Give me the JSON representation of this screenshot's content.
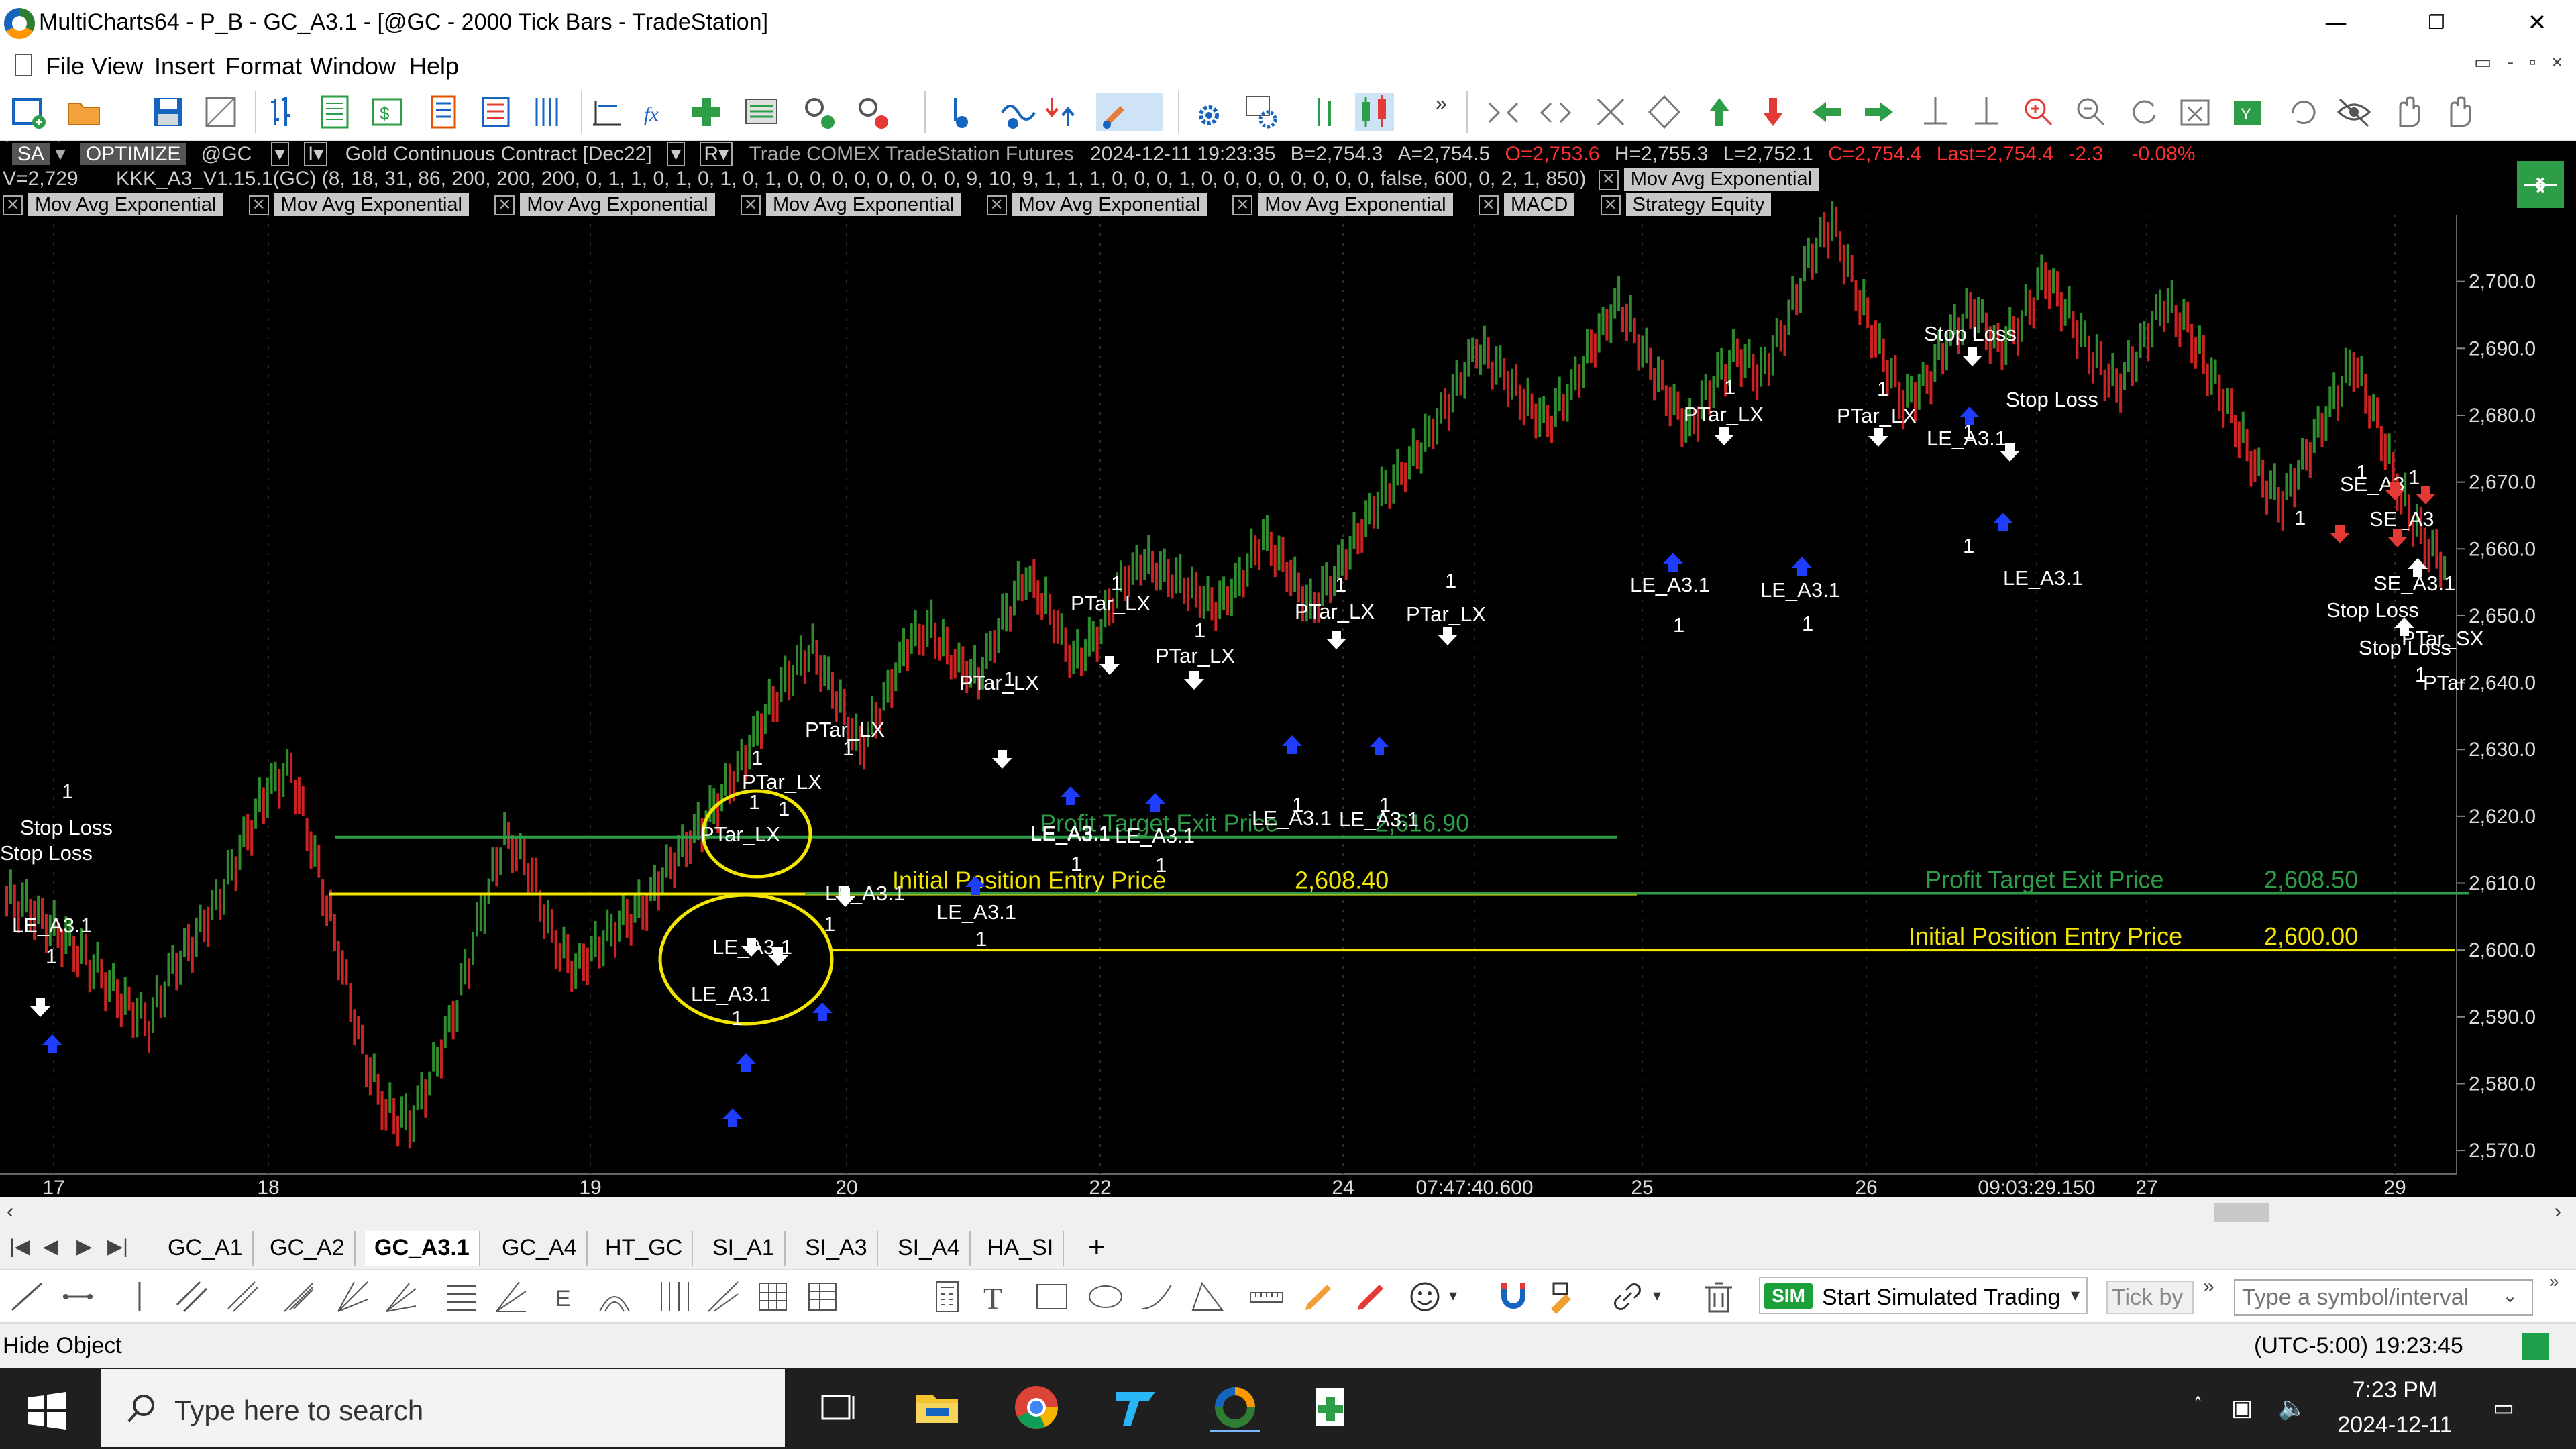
{
  "window": {
    "title": "MultiCharts64 - P_B - GC_A3.1 - [@GC - 2000 Tick Bars - TradeStation]",
    "controls": [
      "—",
      "❐",
      "✕"
    ]
  },
  "menu": {
    "items": [
      "File",
      "View",
      "Insert",
      "Format",
      "Window",
      "Help"
    ]
  },
  "chart_header": {
    "mode": "SA",
    "optimize": "OPTIMIZE",
    "symbol": "@GC",
    "interval_marker": "I▾",
    "description": "Gold Continuous Contract [Dec22]",
    "r_marker": "R▾",
    "feed": "Trade  COMEX  TradeStation  Futures",
    "datetime": "2024-12-11   19:23:35",
    "bid": "B=2,754.3",
    "ask": "A=2,754.5",
    "open": "O=2,753.6",
    "high": "H=2,755.3",
    "low": "L=2,752.1",
    "close": "C=2,754.4",
    "last": "Last=2,754.4",
    "change": "-2.3",
    "change_pct": "-0.08%",
    "volume": "V=2,729",
    "strategy": "KKK_A3_V1.15.1(GC) (8,  18,  31,  86,  200,  200,  200,  0,  1,  1,  0,  1,  0,  1,  0,  1,  0,  0,  0,  0,  0,  0,  0,  0,  9,  10,  9,  1,  1,  1,  0,  0,  0,  1,  0,  0,  0,  0,  0,  0,  0,  0,  false,  600,  0,  2,  1,  850)",
    "last_indicator": "Mov Avg Exponential",
    "indicators": [
      "Mov Avg Exponential",
      "Mov Avg Exponential",
      "Mov Avg Exponential",
      "Mov Avg Exponential",
      "Mov Avg Exponential",
      "Mov Avg Exponential",
      "MACD",
      "Strategy Equity"
    ]
  },
  "chart_data": {
    "type": "line",
    "series": [
      {
        "values": [
          2608,
          2606,
          2603,
          2600,
          2596,
          2592,
          2589,
          2597,
          2602,
          2608,
          2616,
          2624,
          2627,
          2614,
          2600,
          2585,
          2576,
          2574,
          2582,
          2592,
          2605,
          2617,
          2613,
          2602,
          2597,
          2601,
          2604,
          2607,
          2613,
          2617,
          2622,
          2628,
          2635,
          2641,
          2645,
          2638,
          2630,
          2637,
          2646,
          2648,
          2643,
          2641,
          2649,
          2656,
          2651,
          2643,
          2647,
          2655,
          2658,
          2656,
          2654,
          2651,
          2655,
          2662,
          2657,
          2651,
          2656,
          2662,
          2668,
          2672,
          2677,
          2683,
          2690,
          2687,
          2682,
          2679,
          2684,
          2691,
          2697,
          2690,
          2683,
          2678,
          2685,
          2689,
          2686,
          2693,
          2703,
          2709,
          2699,
          2690,
          2682,
          2685,
          2692,
          2696,
          2690,
          2694,
          2701,
          2695,
          2689,
          2684,
          2690,
          2697,
          2693,
          2686,
          2679,
          2671,
          2667,
          2674,
          2681,
          2688,
          2679,
          2668,
          2661,
          2657
        ]
      }
    ],
    "y_ticks": [
      "2,700.0",
      "2,690.0",
      "2,680.0",
      "2,670.0",
      "2,660.0",
      "2,650.0",
      "2,640.0",
      "2,630.0",
      "2,620.0",
      "2,610.0",
      "2,600.0",
      "2,590.0",
      "2,580.0",
      "2,570.0"
    ],
    "ylim": [
      2567,
      2710
    ],
    "x_ticks": [
      "17",
      "18",
      "19",
      "20",
      "22",
      "24",
      "07:47:40.600",
      "25",
      "26",
      "09:03:29.150",
      "27",
      "29"
    ],
    "price_lines": [
      {
        "label": "Profit Target Exit Price",
        "value_label": "2,616.90",
        "value": 2616.9,
        "color": "#2e9d48"
      },
      {
        "label": "Initial Position Entry Price",
        "value_label": "2,608.40",
        "value": 2608.4,
        "color": "#f2e600"
      },
      {
        "label": "Profit Target Exit Price",
        "value_label": "2,608.50",
        "value": 2608.5,
        "color": "#2e9d48"
      },
      {
        "label": "Initial Position Entry Price",
        "value_label": "2,600.00",
        "value": 2600.0,
        "color": "#f2e600"
      }
    ],
    "trade_labels": [
      "Stop Loss",
      "1",
      "Stop Loss",
      "LE_A3.1",
      "1",
      "PTar_LX",
      "1",
      "PTar_LX",
      "1",
      "LE_A3.1",
      "1",
      "LE_A3.1",
      "1",
      "LE_A3.1",
      "1",
      "PTar_LX",
      "1",
      "LE_A3.1",
      "1",
      "PTar_LX",
      "1",
      "LE_A3.1",
      "1",
      "PTar_LX",
      "1",
      "LE_A3.1",
      "1",
      "PTar_LX",
      "1",
      "LE_A3.1",
      "1",
      "PTar_LX",
      "1",
      "LE_A3.1",
      "1",
      "PTar_LX",
      "1",
      "LE_A3.1",
      "1",
      "PTar_LX",
      "1",
      "LE_A3.1",
      "1",
      "LE_A3.1",
      "1",
      "PTar_LX",
      "1",
      "Stop Loss",
      "LE_A3.1",
      "1",
      "Stop Loss",
      "1",
      "LE_A3.1",
      "1",
      "SE_A3",
      "1",
      "SE_A3",
      "SE_A3.1",
      "Stop Loss",
      "Stop Loss",
      "PTar_SX",
      "1",
      "PTar",
      "1",
      "SE_A3.1"
    ]
  },
  "tabs": {
    "nav": [
      "|◀",
      "◀",
      "▶",
      "▶|"
    ],
    "items": [
      "GC_A1",
      "GC_A2",
      "GC_A3.1",
      "GC_A4",
      "HT_GC",
      "SI_A1",
      "SI_A3",
      "SI_A4",
      "HA_SI"
    ],
    "active": "GC_A3.1",
    "add": "+"
  },
  "trading": {
    "sim_badge": "SIM",
    "sim_label": "Start Simulated Trading",
    "tick_by": "Tick by",
    "symbol_placeholder": "Type a symbol/interval"
  },
  "statusbar": {
    "left": "Hide Object",
    "time": "(UTC-5:00) 19:23:45"
  },
  "taskbar": {
    "search_placeholder": "Type here to search",
    "time": "7:23 PM",
    "date": "2024-12-11"
  },
  "colors": {
    "chart_bg": "#000000",
    "up_bar": "#2e8b2e",
    "down_bar": "#cc2222",
    "profit_line": "#2e9d48",
    "entry_line": "#f2e600",
    "header_red": "#ff3030",
    "taskbar": "#1f1f1f"
  }
}
